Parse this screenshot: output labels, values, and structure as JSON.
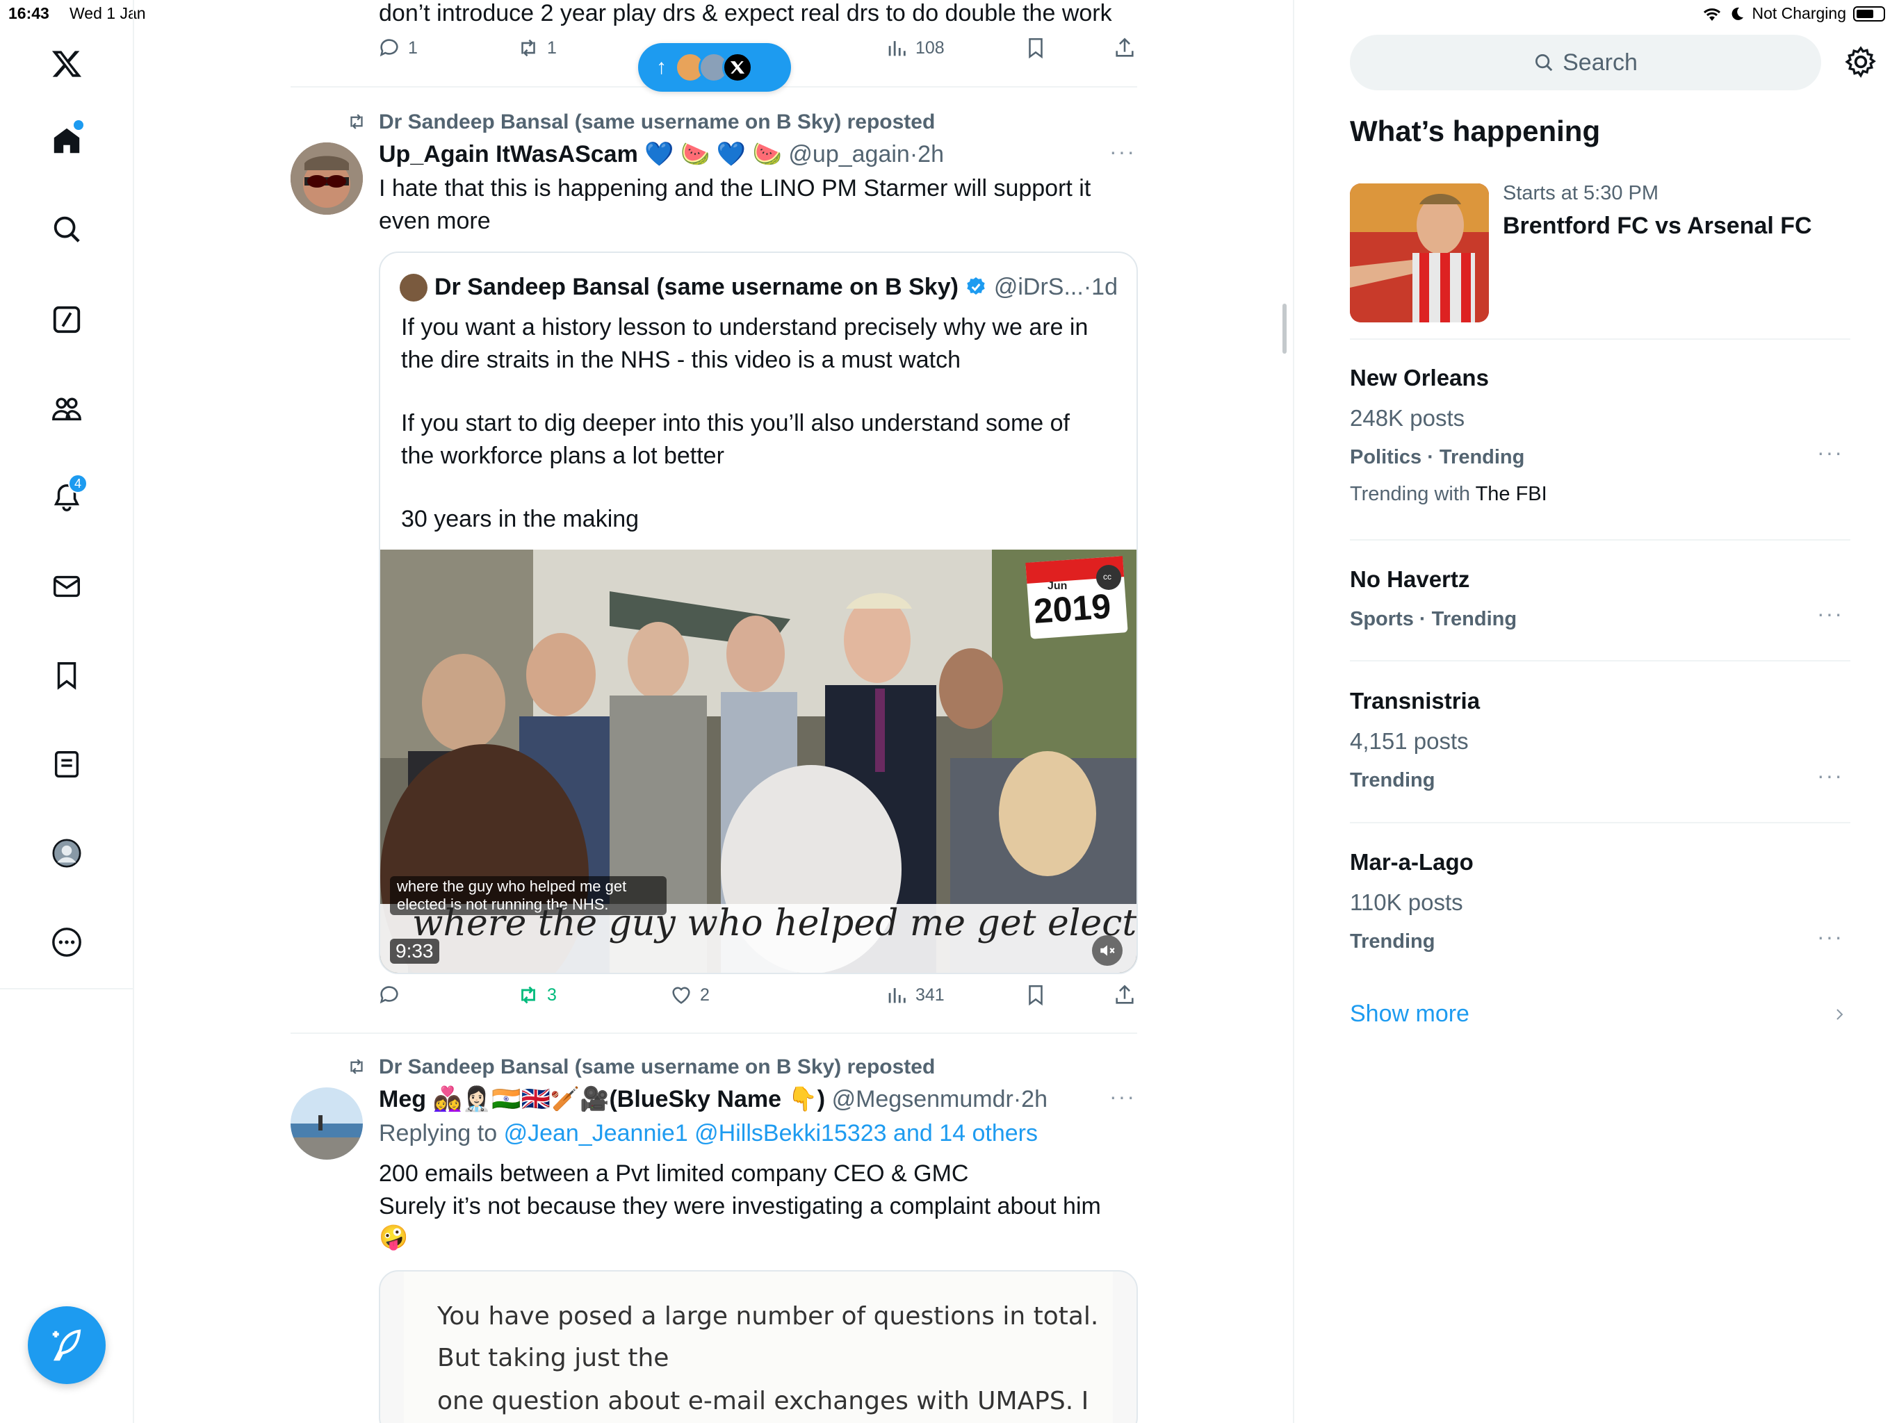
{
  "status": {
    "time": "16:43",
    "date": "Wed 1 Jan",
    "battery": "Not Charging"
  },
  "nav": {
    "notifications_badge": "4",
    "icons": [
      "x-logo-icon",
      "home-icon",
      "search-icon",
      "grok-icon",
      "communities-icon",
      "notifications-icon",
      "messages-icon",
      "bookmarks-icon",
      "lists-icon",
      "profile-icon",
      "more-icon",
      "compose-icon"
    ]
  },
  "feed": {
    "top_tweet": {
      "text": "don’t introduce 2 year play drs & expect real drs to do double the work",
      "replies": "1",
      "reposts": "1",
      "views": "108"
    },
    "new_posts_pill": {
      "arrow": "↑"
    },
    "tweet1": {
      "repost_label": "Dr Sandeep Bansal (same username on B Sky) reposted",
      "name": "Up_Again ItWasAScam 💙 🍉 💙 🍉",
      "handle": "@up_again",
      "time": "2h",
      "text_line1": "I hate that this is happening and the LINO PM Starmer will support it",
      "text_line2": "even more",
      "quote": {
        "name": "Dr Sandeep Bansal (same username on B Sky)",
        "handle": "@iDrS...",
        "time": "1d",
        "p1_line1": "If you want a history lesson to understand precisely why we are in",
        "p1_line2": "the dire straits in the NHS - this video is a must watch",
        "p2_line1": "If you start to dig deeper into this you’ll also understand some of",
        "p2_line2": "the workforce plans a lot better",
        "p3": "30 years in the making",
        "video": {
          "calendar_month": "Jun",
          "calendar_year": "2019",
          "cc_label": "cc",
          "caption_small_line1": "where the guy who helped me get",
          "caption_small_line2": "elected is not running the NHS.",
          "caption_large": "where the guy who helped me get elected",
          "duration": "9:33"
        }
      },
      "replies": "",
      "reposts": "3",
      "likes": "2",
      "views": "341"
    },
    "tweet2": {
      "repost_label": "Dr Sandeep Bansal (same username on B Sky) reposted",
      "name": "Meg 👩‍❤️‍👩👩🏻‍⚕️🇮🇳🇬🇧🏏🎥(BlueSky Name 👇)",
      "handle": "@Megsenmumdr",
      "time": "2h",
      "replying_to_label": "Replying to",
      "replying_to": "@Jean_Jeannie1 @HillsBekki15323 and 14 others",
      "text_line1": "200 emails between a Pvt limited company CEO & GMC",
      "text_line2": "Surely it’s not because they were investigating a complaint about him",
      "text_line3": "🤪",
      "doc_line1": "You have posed a large number of questions in total.",
      "doc_line2": "But taking just the",
      "doc_line3": "one question about e-mail exchanges with UMAPS. I"
    }
  },
  "sidebar": {
    "search_placeholder": "Search",
    "title": "What’s happening",
    "event": {
      "time": "Starts at 5:30 PM",
      "title": "Brentford FC vs Arsenal FC"
    },
    "trends": [
      {
        "name": "New Orleans",
        "posts": "248K posts",
        "category": "Politics · Trending",
        "with_label": "Trending with",
        "with": "The FBI"
      },
      {
        "name": "No Havertz",
        "category": "Sports · Trending"
      },
      {
        "name": "Transnistria",
        "posts": "4,151 posts",
        "category": "Trending"
      },
      {
        "name": "Mar-a-Lago",
        "posts": "110K posts",
        "category": "Trending"
      }
    ],
    "show_more": "Show more"
  },
  "colors": {
    "accent": "#1d9bf0",
    "repost_green": "#00ba7c",
    "muted": "#536471"
  }
}
